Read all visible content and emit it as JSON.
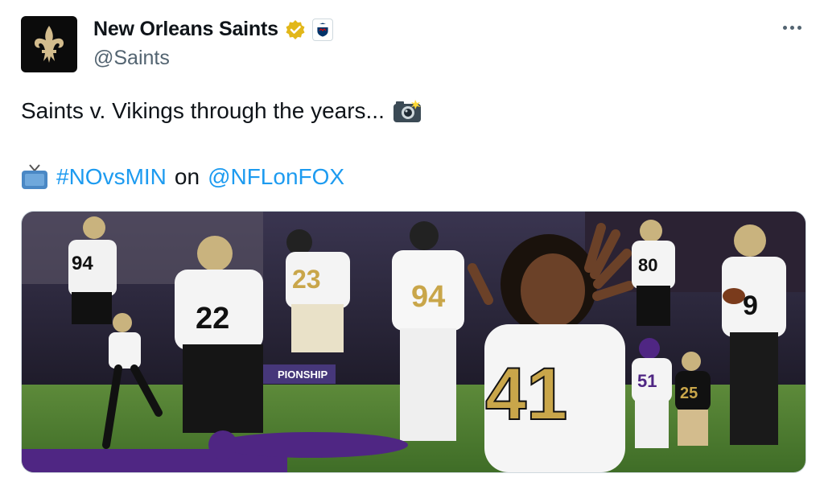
{
  "author": {
    "display_name": "New Orleans Saints",
    "handle": "@Saints",
    "avatar_icon": "fleur-de-lis-icon",
    "verified_icon": "verified-badge-icon",
    "affiliate_icon": "nfl-shield-icon",
    "affiliate_label": "NFL"
  },
  "menu": {
    "icon": "more-options-icon"
  },
  "tweet": {
    "text_line1": "Saints v. Vikings through the years...",
    "emoji_camera": "camera-flash-icon",
    "emoji_tv": "television-icon",
    "hashtag": "#NOvsMIN",
    "on_word": "on",
    "mention": "@NFLonFOX"
  },
  "media": {
    "description_icon": "photo-collage",
    "jersey_numbers": [
      "94",
      "22",
      "23",
      "94",
      "41",
      "80",
      "9",
      "51",
      "25"
    ],
    "banner_text": "PIONSHIP"
  },
  "colors": {
    "link": "#1d9bf0",
    "secondary_text": "#536471",
    "verified_gold": "#e2b719",
    "saints_gold": "#d3bc8d",
    "vikings_purple": "#4f2683"
  }
}
